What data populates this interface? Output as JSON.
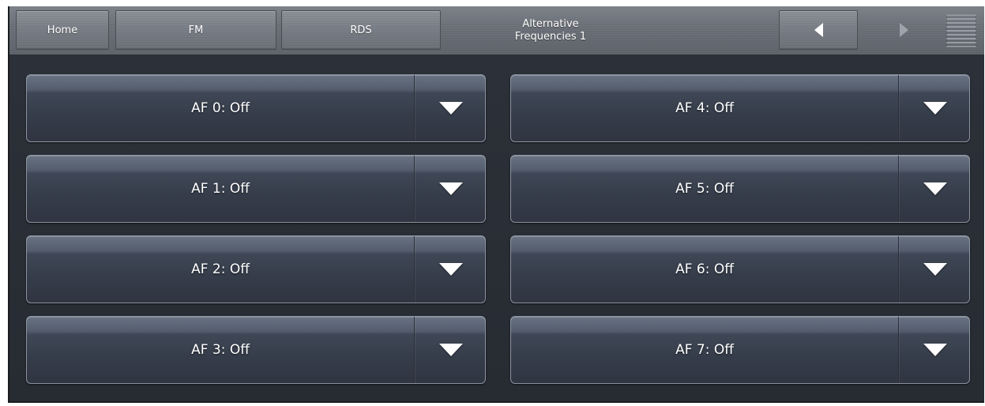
{
  "navbar": {
    "home_label": "Home",
    "fm_label": "FM",
    "rds_label": "RDS",
    "title_line1": "Alternative",
    "title_line2": "Frequencies 1",
    "prev_icon": "triangle-left",
    "next_icon": "triangle-right",
    "menu_icon": "hamburger-lines"
  },
  "af_settings": [
    {
      "label": "AF 0: Off"
    },
    {
      "label": "AF 1: Off"
    },
    {
      "label": "AF 2: Off"
    },
    {
      "label": "AF 3: Off"
    },
    {
      "label": "AF 4: Off"
    },
    {
      "label": "AF 5: Off"
    },
    {
      "label": "AF 6: Off"
    },
    {
      "label": "AF 7: Off"
    }
  ],
  "colors": {
    "background": "#2a2f37",
    "navbar": "#6b6f77",
    "dropdown_top": "#6a7384",
    "dropdown_bottom": "#2f3541",
    "text": "#ffffff"
  }
}
